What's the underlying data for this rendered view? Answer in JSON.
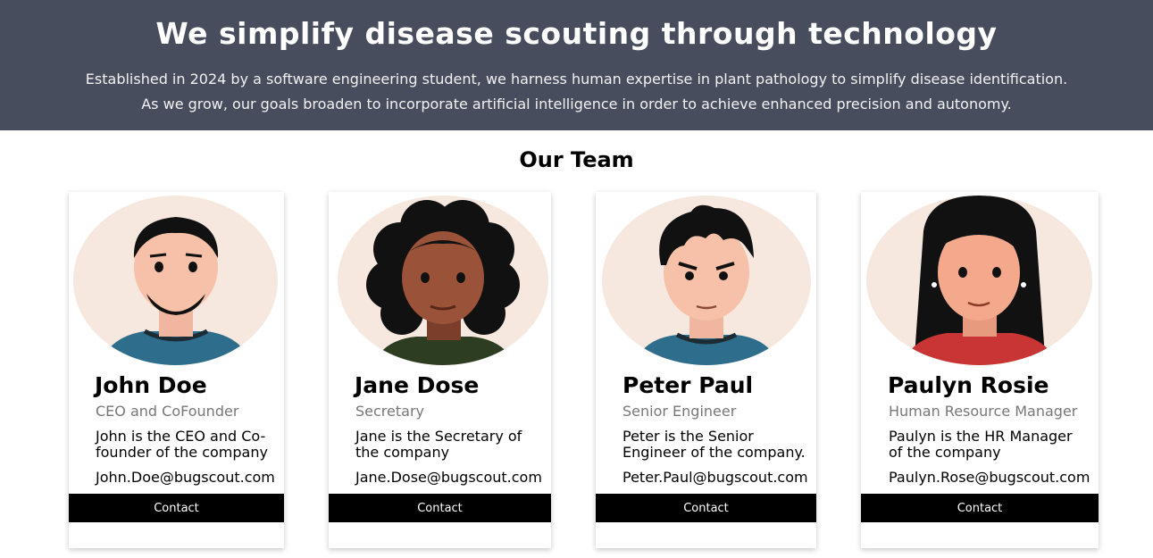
{
  "hero": {
    "title": "We simplify disease scouting through technology",
    "line1": "Established in 2024 by a software engineering student, we harness human expertise in plant pathology to simplify disease identification.",
    "line2": "As we grow, our goals broaden to incorporate artificial intelligence in order to achieve enhanced precision and autonomy."
  },
  "team": {
    "title": "Our Team",
    "members": [
      {
        "name": "John Doe",
        "role": "CEO and CoFounder",
        "bio_line1": "John is the CEO and Co-",
        "bio_line2": "founder of the company",
        "email": "John.Doe@bugscout.com",
        "button": "Contact"
      },
      {
        "name": "Jane Dose",
        "role": "Secretary",
        "bio_line1": "Jane is the Secretary of",
        "bio_line2": "the company",
        "email": "Jane.Dose@bugscout.com",
        "button": "Contact"
      },
      {
        "name": "Peter Paul",
        "role": "Senior Engineer",
        "bio_line1": "Peter is the Senior",
        "bio_line2": "Engineer of the company.",
        "email": "Peter.Paul@bugscout.com",
        "button": "Contact"
      },
      {
        "name": "Paulyn Rosie",
        "role": "Human Resource Manager",
        "bio_line1": "Paulyn is the HR Manager",
        "bio_line2": "of the company",
        "email": "Paulyn.Rose@bugscout.com",
        "button": "Contact"
      }
    ]
  },
  "colors": {
    "hero_bg": "#474d5d",
    "avatar_bg": "#f6e8df",
    "button_bg": "#000000",
    "role_text": "#777777"
  }
}
